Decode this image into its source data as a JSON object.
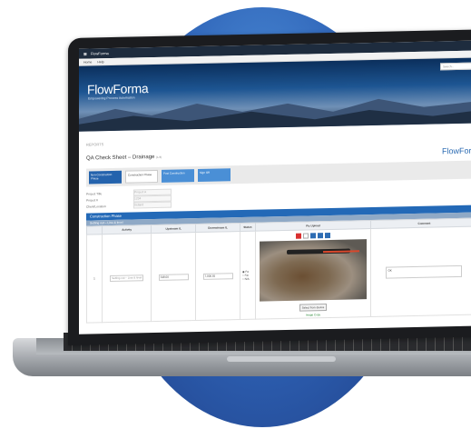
{
  "app": {
    "window_title": "FlowForma",
    "menu": [
      "Home",
      "Help"
    ],
    "search_placeholder": "Search..."
  },
  "banner": {
    "brand": "FlowForma",
    "tagline": "Empowering Process Automation"
  },
  "breadcrumb": "REPORTS",
  "form": {
    "title": "QA Check Sheet – Drainage",
    "title_suffix": "(1/4)",
    "logo": "FlowForm",
    "steps": [
      {
        "label": "Non-Construction Phase"
      },
      {
        "label": "Construction Phase"
      },
      {
        "label": "Post Construction"
      },
      {
        "label": "Sign Off"
      }
    ],
    "meta": [
      {
        "key": "Project Title",
        "value": "Project A"
      },
      {
        "key": "Project #",
        "value": "1234"
      },
      {
        "key": "Client/Location",
        "value": "Ireland"
      }
    ],
    "phase_header": "Construction Phase",
    "section_header": "Setting out – Line & level",
    "table": {
      "columns": [
        "",
        "Activity",
        "Upstream IL",
        "Downstream IL",
        "Status",
        "Pic Upload",
        "Comment"
      ],
      "row": {
        "num": "1",
        "activity": "Setting out – Line & level",
        "upstream": "548.00",
        "downstream": "7,000.55",
        "status_options": [
          "Pa",
          "Fai",
          "N/A"
        ],
        "upload_button": "Select from device",
        "image_link": "Image Copy",
        "comment": "OK"
      }
    }
  }
}
